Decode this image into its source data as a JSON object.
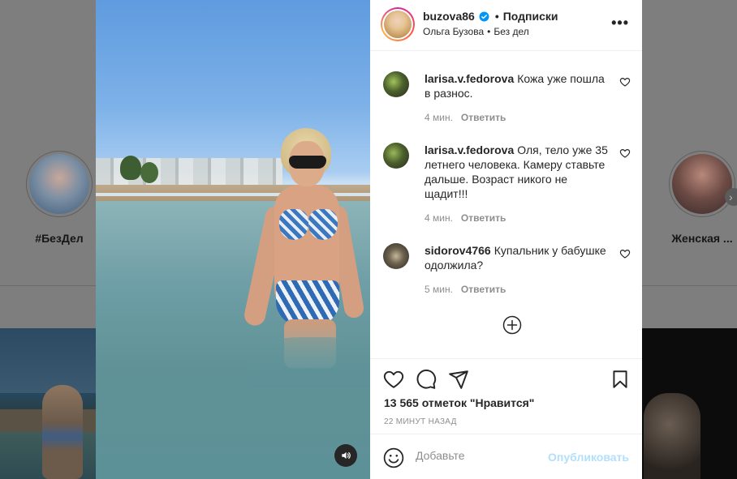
{
  "background": {
    "highlights": [
      {
        "label": "#БезДел"
      },
      {
        "label": "Женская ..."
      }
    ]
  },
  "post": {
    "username": "buzova86",
    "follow_label": "Подписки",
    "separator": "•",
    "author_name": "Ольга Бузова",
    "sub_separator": "•",
    "location": "Без дел",
    "more_glyph": "•••",
    "comments": [
      {
        "user": "larisa.v.fedorova",
        "text": "Кожа уже пошла в разнос.",
        "time": "4 мин.",
        "reply": "Ответить"
      },
      {
        "user": "larisa.v.fedorova",
        "text": "Оля, тело уже 35 летнего человека. Камеру ставьте дальше. Возраст никого не щадит!!!",
        "time": "4 мин.",
        "reply": "Ответить"
      },
      {
        "user": "sidorov4766",
        "text": "Купальник у бабушке одолжила?",
        "time": "5 мин.",
        "reply": "Ответить"
      }
    ],
    "likes_text": "13 565 отметок \"Нравится\"",
    "posted_ago": "22 МИНУТ НАЗАД",
    "comment_placeholder": "Добавьте",
    "publish_label": "Опубликовать"
  },
  "colors": {
    "accent": "#0095f6",
    "publish_disabled": "#b2dffc",
    "muted_text": "#8e8e8e",
    "primary_text": "#262626"
  }
}
